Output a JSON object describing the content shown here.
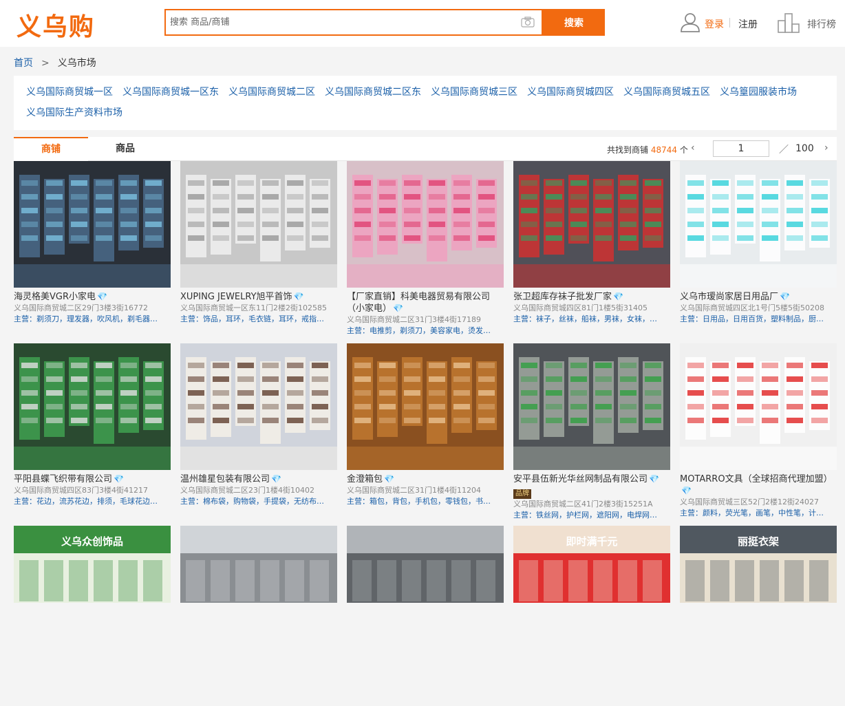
{
  "header": {
    "logo": "义乌购",
    "search_placeholder": "搜索 商品/商铺",
    "search_button": "搜索",
    "login": "登录",
    "register": "注册",
    "ranking": "排行榜"
  },
  "breadcrumb": {
    "home": "首页",
    "arrow": ">",
    "current": "义乌市场"
  },
  "markets": [
    "义乌国际商贸城一区",
    "义乌国际商贸城一区东",
    "义乌国际商贸城二区",
    "义乌国际商贸城二区东",
    "义乌国际商贸城三区",
    "义乌国际商贸城四区",
    "义乌国际商贸城五区",
    "义乌篁园服装市场",
    "义乌国际生产资料市场"
  ],
  "tabs": {
    "shops": "商铺",
    "products": "商品"
  },
  "results": {
    "prefix": "共找到商铺",
    "count": "48744",
    "suffix": "个"
  },
  "pager": {
    "prev": "‹",
    "page": "1",
    "slash": "／",
    "total": "100",
    "next": "›"
  },
  "shops": [
    {
      "name": "海灵格美VGR小家电",
      "addr": "义乌国际商贸城二区29门3楼3街16772",
      "main": "主营：剃须刀，理发器，吹风机，剃毛器…",
      "theme": "electronics"
    },
    {
      "name": "XUPING JEWELRY旭平首饰",
      "addr": "义乌国际商贸城一区东11门2楼2街102585",
      "main": "主营：饰品，耳环，毛衣链，耳环，戒指…",
      "theme": "jewelry"
    },
    {
      "name": "【厂家直销】科美电器贸易有限公司（小家电）",
      "addr": "义乌国际商贸城二区31门3楼4街17189",
      "main": "主营：电推剪，剃须刀，美容家电，烫发…",
      "theme": "appliance"
    },
    {
      "name": "张卫超库存袜子批发厂家",
      "addr": "义乌国际商贸城四区81门1楼5街31405",
      "main": "主营：袜子，丝袜，船袜，男袜，女袜，…",
      "theme": "socks"
    },
    {
      "name": "义乌市瑷尚家居日用品厂",
      "addr": "义乌国际商贸城四区北1号门5楼5街50208",
      "main": "主营：日用品，日用百货，塑料制品，厨…",
      "theme": "home"
    },
    {
      "name": "平阳县蝶飞织带有限公司",
      "addr": "义乌国际商贸城四区83门3楼4街41217",
      "main": "主营：花边，流苏花边，排须，毛球花边…",
      "theme": "ribbon"
    },
    {
      "name": "温州雄星包装有限公司",
      "addr": "义乌国际商贸城二区23门1楼4街10402",
      "main": "主营：棉布袋，购物袋，手提袋，无纺布…",
      "theme": "packaging"
    },
    {
      "name": "金澄箱包",
      "addr": "义乌国际商贸城二区31门1楼4街11204",
      "main": "主营：箱包，背包，手机包，零钱包，书…",
      "theme": "plush"
    },
    {
      "name": "安平县伍新光华丝网制品有限公司",
      "badge": "品牌",
      "addr": "义乌国际商贸城二区41门2楼3街15251A",
      "main": "主营：铁丝网，护栏网，遮阳网，电焊网…",
      "theme": "mesh"
    },
    {
      "name": "MOTARRO文具（全球招商代理加盟）",
      "addr": "义乌国际商贸城三区52门2楼12街24027",
      "main": "主营：颜料，荧光笔，画笔，中性笔，计…",
      "theme": "stationery"
    }
  ],
  "row3_banners": [
    "义乌众创饰品",
    "",
    "",
    "即时满千元",
    "丽挺衣架"
  ],
  "colors": {
    "accent": "#f26a10",
    "link": "#1a5fa8",
    "gem": "#3bb3e8"
  }
}
